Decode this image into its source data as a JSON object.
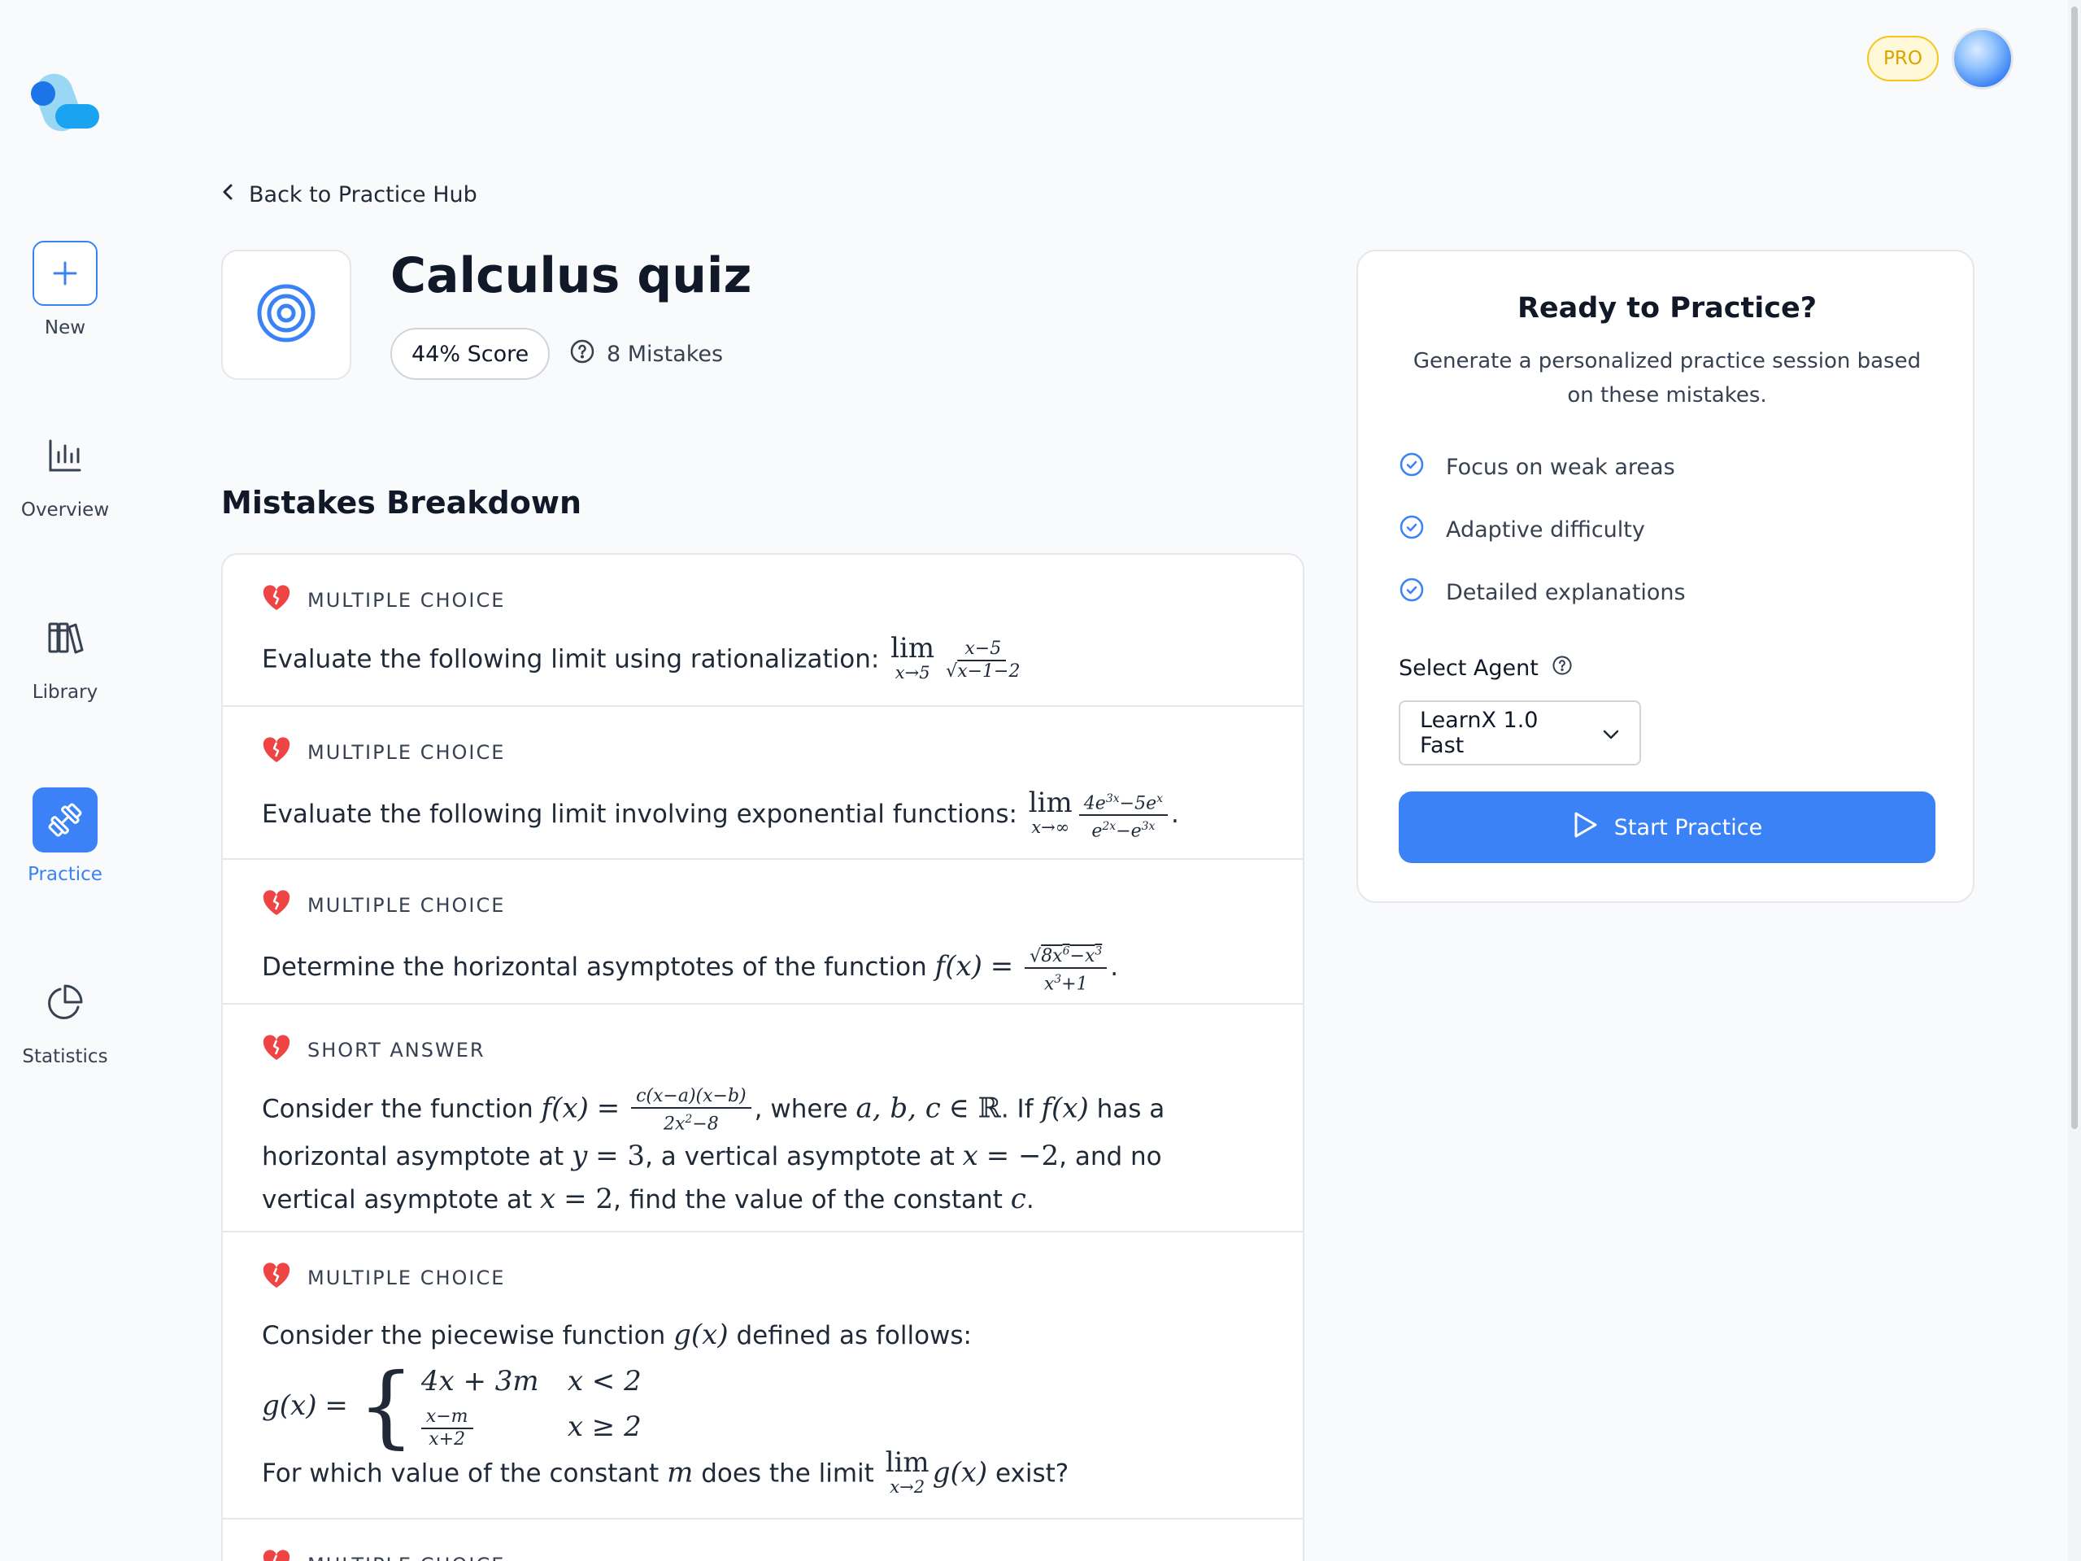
{
  "sidebar": {
    "items": [
      {
        "label": "New",
        "icon": "plus-icon"
      },
      {
        "label": "Overview",
        "icon": "bar-chart-icon"
      },
      {
        "label": "Library",
        "icon": "books-icon"
      },
      {
        "label": "Practice",
        "icon": "dumbbell-icon",
        "active": true
      },
      {
        "label": "Statistics",
        "icon": "pie-chart-icon"
      }
    ]
  },
  "header": {
    "pro_badge": "PRO",
    "back_link": "Back to Practice Hub",
    "title": "Calculus quiz",
    "score": "44% Score",
    "mistakes": "8 Mistakes"
  },
  "section_title": "Mistakes Breakdown",
  "mistakes": [
    {
      "type": "MULTIPLE CHOICE",
      "text": "Evaluate the following limit using rationalization:"
    },
    {
      "type": "MULTIPLE CHOICE",
      "text": "Evaluate the following limit involving exponential functions:"
    },
    {
      "type": "MULTIPLE CHOICE",
      "text": "Determine the horizontal asymptotes of the function"
    },
    {
      "type": "SHORT ANSWER",
      "text_a": "Consider the function",
      "text_b": ", where",
      "text_c": ". If",
      "text_d": "has a horizontal asymptote at",
      "text_e": ", a vertical asymptote at",
      "text_f": ", and no vertical asymptote at",
      "text_g": ", find the value of the constant"
    },
    {
      "type": "MULTIPLE CHOICE",
      "text_a": "Consider the piecewise function",
      "text_b": "defined as follows:",
      "text_c": "For which value of the constant",
      "text_d": "does the limit",
      "text_e": "exist?"
    },
    {
      "type": "MULTIPLE CHOICE"
    }
  ],
  "practice_panel": {
    "title": "Ready to Practice?",
    "description": "Generate a personalized practice session based on these mistakes.",
    "features": [
      "Focus on weak areas",
      "Adaptive difficulty",
      "Detailed explanations"
    ],
    "agent_label": "Select Agent",
    "agent_value": "LearnX 1.0 Fast",
    "start_button": "Start Practice"
  },
  "colors": {
    "accent": "#3b82f6",
    "pro": "#f5c518",
    "mistake_heart": "#ef4444"
  }
}
